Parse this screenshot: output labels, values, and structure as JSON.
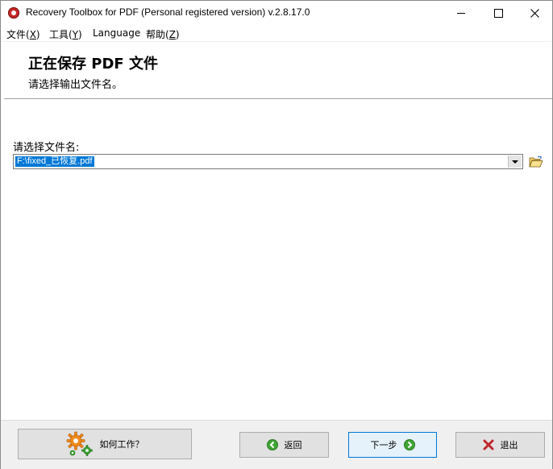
{
  "window": {
    "title": "Recovery Toolbox for PDF (Personal registered version) v.2.8.17.0"
  },
  "menu": [
    {
      "label": "文件(",
      "key": "X",
      "end": ")"
    },
    {
      "label": "工具(",
      "key": "Y",
      "end": ")"
    },
    {
      "label": "Language",
      "key": "",
      "end": ""
    },
    {
      "label": "帮助(",
      "key": "Z",
      "end": ")"
    }
  ],
  "header": {
    "title": "正在保存 PDF 文件",
    "subtitle": "请选择输出文件名。"
  },
  "file": {
    "label": "请选择文件名:",
    "value": "F:\\fixed_已恢复.pdf"
  },
  "buttons": {
    "how": "如何工作？",
    "back": "返回",
    "next": "下一步",
    "exit": "退出"
  },
  "colors": {
    "selection": "#0078d7",
    "app_icon": "#c62828",
    "green_icon": "#3fa535",
    "gear": "#f08a1c",
    "exit_x": "#c0272d"
  },
  "icons": {
    "app": "recovery-toolbox-icon",
    "browse": "open-folder-icon",
    "how": "gears-icon",
    "back": "arrow-left-icon",
    "next": "arrow-right-icon",
    "exit": "x-icon"
  }
}
